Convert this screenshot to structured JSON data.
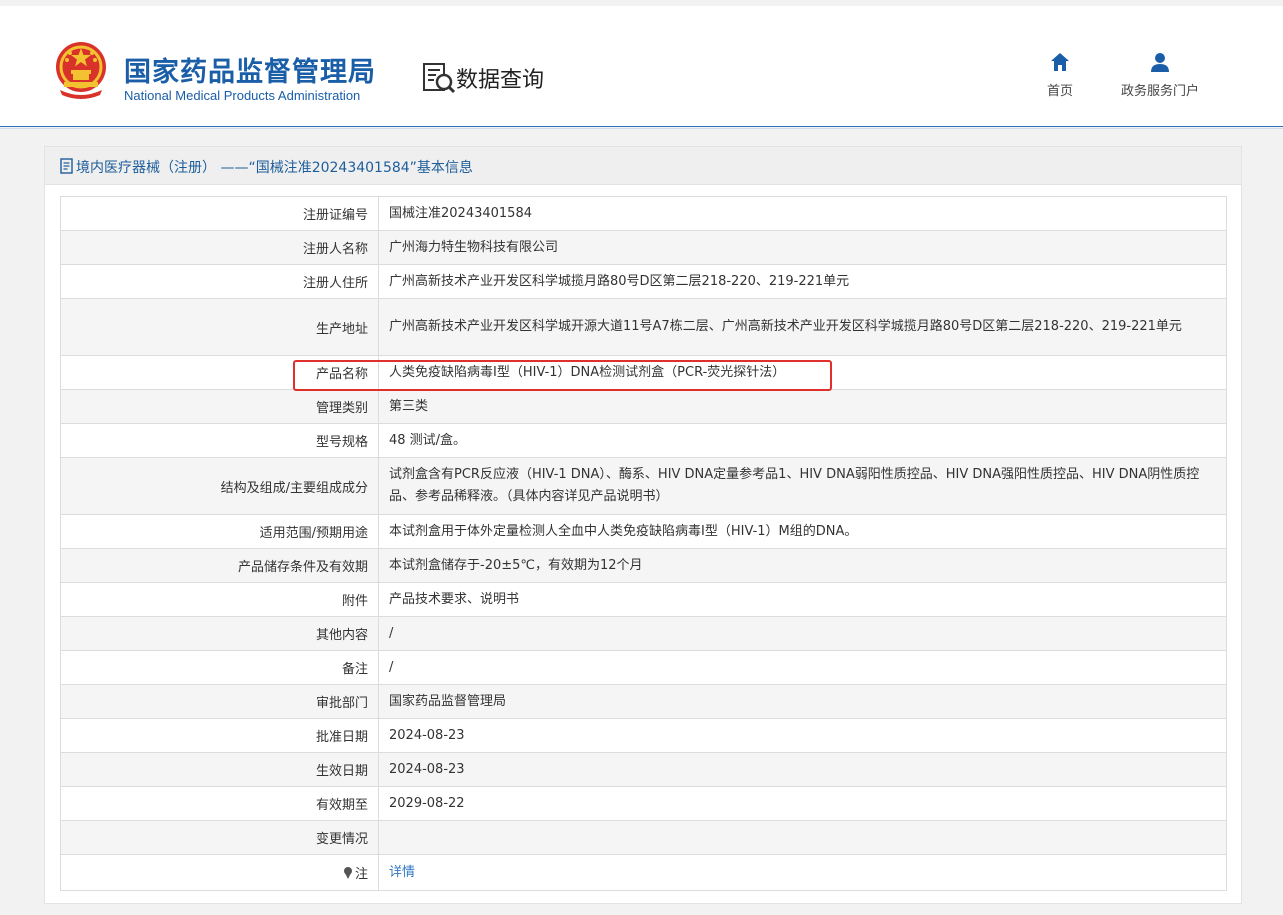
{
  "header": {
    "org_name_cn": "国家药品监督管理局",
    "org_name_en": "National Medical Products Administration",
    "section_title": "数据查询",
    "nav": {
      "home_label": "首页",
      "portal_label": "政务服务门户"
    }
  },
  "panel": {
    "title": "境内医疗器械（注册） ——“国械注准20243401584”基本信息"
  },
  "record": {
    "rows": [
      {
        "label": "注册证编号",
        "value": "国械注准20243401584"
      },
      {
        "label": "注册人名称",
        "value": "广州海力特生物科技有限公司"
      },
      {
        "label": "注册人住所",
        "value": "广州高新技术产业开发区科学城揽月路80号D区第二层218-220、219-221单元"
      },
      {
        "label": "生产地址",
        "value": "广州高新技术产业开发区科学城开源大道11号A7栋二层、广州高新技术产业开发区科学城揽月路80号D区第二层218-220、219-221单元"
      },
      {
        "label": "产品名称",
        "value": "人类免疫缺陷病毒I型（HIV-1）DNA检测试剂盒（PCR-荧光探针法）"
      },
      {
        "label": "管理类别",
        "value": "第三类"
      },
      {
        "label": "型号规格",
        "value": "48 测试/盒。"
      },
      {
        "label": "结构及组成/主要组成成分",
        "value": "试剂盒含有PCR反应液（HIV-1 DNA）、酶系、HIV DNA定量参考品1、HIV DNA弱阳性质控品、HIV DNA强阳性质控品、HIV DNA阴性质控品、参考品稀释液。（具体内容详见产品说明书）"
      },
      {
        "label": "适用范围/预期用途",
        "value": "本试剂盒用于体外定量检测人全血中人类免疫缺陷病毒I型（HIV-1）M组的DNA。"
      },
      {
        "label": "产品储存条件及有效期",
        "value": "本试剂盒储存于-20±5℃，有效期为12个月"
      },
      {
        "label": "附件",
        "value": "产品技术要求、说明书"
      },
      {
        "label": "其他内容",
        "value": "/"
      },
      {
        "label": "备注",
        "value": "/"
      },
      {
        "label": "审批部门",
        "value": "国家药品监督管理局"
      },
      {
        "label": "批准日期",
        "value": "2024-08-23"
      },
      {
        "label": "生效日期",
        "value": "2024-08-23"
      },
      {
        "label": "有效期至",
        "value": "2029-08-22"
      },
      {
        "label": "变更情况",
        "value": ""
      },
      {
        "label": "注",
        "value": "详情"
      }
    ]
  },
  "colors": {
    "brand_blue": "#1a5ea8",
    "link_blue": "#2f77c4",
    "highlight_red": "#e0302c"
  },
  "icons": {
    "emblem": "national-emblem-icon",
    "query": "document-search-icon",
    "home": "home-icon",
    "portal": "user-icon",
    "panel_head": "document-icon",
    "note": "pin-icon"
  }
}
